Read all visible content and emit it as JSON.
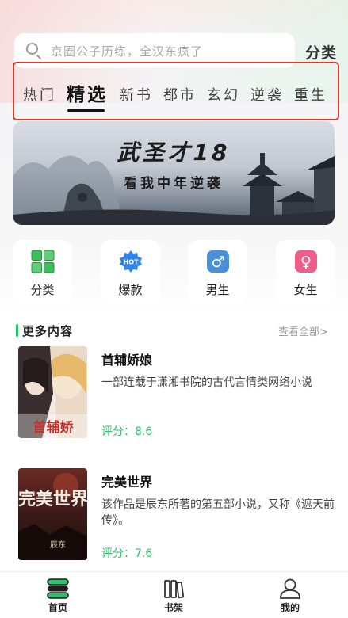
{
  "search": {
    "placeholder": "京圈公子历练，全汉东疯了",
    "category_link": "分类"
  },
  "tabs": [
    {
      "label": "热门",
      "active": false
    },
    {
      "label": "精选",
      "active": true
    },
    {
      "label": "新书",
      "active": false
    },
    {
      "label": "都市",
      "active": false
    },
    {
      "label": "玄幻",
      "active": false
    },
    {
      "label": "逆袭",
      "active": false
    },
    {
      "label": "重生",
      "active": false
    }
  ],
  "banner": {
    "title": "武圣才18",
    "subtitle": "看我中年逆袭"
  },
  "quick_entries": [
    {
      "label": "分类",
      "icon": "grid-icon"
    },
    {
      "label": "爆款",
      "icon": "hot-badge-icon",
      "badge_text": "HOT"
    },
    {
      "label": "男生",
      "icon": "male-icon",
      "symbol": "♂"
    },
    {
      "label": "女生",
      "icon": "female-icon",
      "symbol": "♀"
    }
  ],
  "section": {
    "title": "更多内容",
    "more": "查看全部>"
  },
  "books": [
    {
      "title": "首辅娇娘",
      "description": "一部连载于潇湘书院的古代言情类网络小说",
      "score": "评分：8.6",
      "cover_text": "首辅娇"
    },
    {
      "title": "完美世界",
      "description": "该作品是辰东所著的第五部小说，又称《遮天前传》。",
      "score": "评分：7.6",
      "cover_text": "完美世界",
      "cover_author": "辰东"
    }
  ],
  "bottom_nav": [
    {
      "label": "首页",
      "icon": "home-icon",
      "active": true
    },
    {
      "label": "书架",
      "icon": "bookshelf-icon",
      "active": false
    },
    {
      "label": "我的",
      "icon": "user-icon",
      "active": false
    }
  ],
  "colors": {
    "accent_green": "#2cc06d",
    "highlight_border": "#d33a2c",
    "male_blue": "#4a90d9",
    "female_pink": "#ef5d8a",
    "hot_blue": "#2f86e8"
  }
}
